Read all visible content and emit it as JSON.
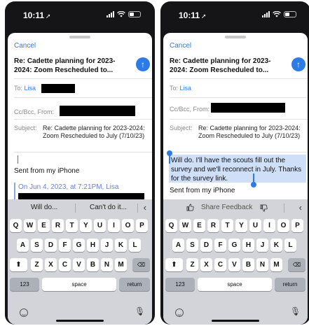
{
  "left_phone": {
    "time": "10:11",
    "cancel_label": "Cancel",
    "title": "Re: Cadette planning for 2023-2024: Zoom Rescheduled to...",
    "to_label": "To:",
    "to_name": "Lisa",
    "ccbcc_label": "Cc/Bcc, From:",
    "subject_label": "Subject:",
    "subject_text": "Re: Cadette planning for 2023-2024: Zoom Rescheduled to July (7/10/23)",
    "signature": "Sent from my iPhone",
    "quote_header": "On Jun 4, 2023, at 7:21PM, Lisa",
    "suggestions": [
      "Will do...",
      "Can't do it..."
    ]
  },
  "right_phone": {
    "time": "10:11",
    "cancel_label": "Cancel",
    "title": "Re: Cadette planning for 2023-2024: Zoom Rescheduled to...",
    "to_label": "To:",
    "to_name": "Lisa",
    "ccbcc_label": "Cc/Bcc, From:",
    "subject_label": "Subject:",
    "subject_text": "Re: Cadette planning for 2023-2024: Zoom Rescheduled to July (7/10/23)",
    "reply_text": "Will do. I'll have the scouts fill out the survey and we'll reconnect in July. Thanks for the survey link.",
    "signature": "Sent from my iPhone",
    "feedback_label": "Share Feedback"
  },
  "keyboard": {
    "row1": [
      "Q",
      "W",
      "E",
      "R",
      "T",
      "Y",
      "U",
      "I",
      "O",
      "P"
    ],
    "row2": [
      "A",
      "S",
      "D",
      "F",
      "G",
      "H",
      "J",
      "K",
      "L"
    ],
    "row3": [
      "Z",
      "X",
      "C",
      "V",
      "B",
      "N",
      "M"
    ],
    "numbers_label": "123",
    "space_label": "space",
    "return_label": "return"
  },
  "icons": {
    "send": "arrow-up-icon",
    "shift": "shift-icon",
    "delete": "backspace-icon",
    "emoji": "emoji-icon",
    "mic": "microphone-icon",
    "thumbs_up": "thumbs-up-icon",
    "thumbs_down": "thumbs-down-icon",
    "chevron": "chevron-left-icon"
  },
  "colors": {
    "accent": "#2f7be6",
    "selection": "#cfdff8",
    "keyboard_bg": "#d2d4d9"
  }
}
